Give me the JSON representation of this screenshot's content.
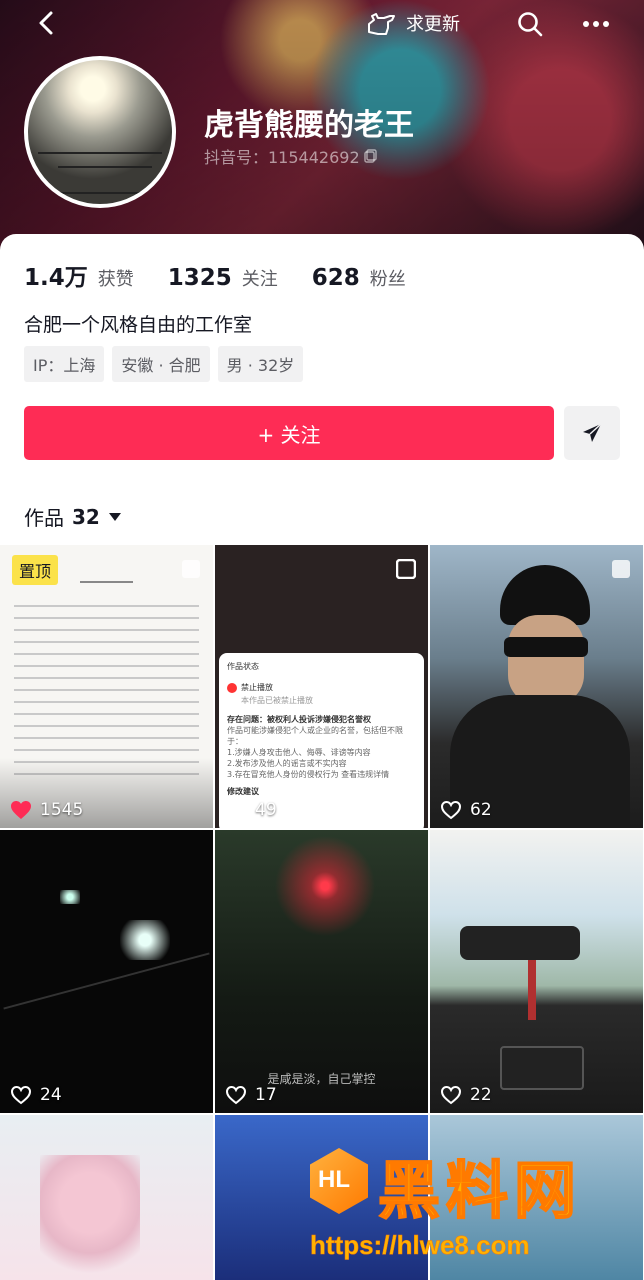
{
  "topbar": {
    "update_label": "求更新"
  },
  "profile": {
    "name": "虎背熊腰的老王",
    "douyin_id": "抖音号：115442692",
    "stats": [
      {
        "num": "1.4万",
        "label": "获赞"
      },
      {
        "num": "1325",
        "label": "关注"
      },
      {
        "num": "628",
        "label": "粉丝"
      }
    ],
    "bio": "合肥一个风格自由的工作室",
    "tags": [
      "IP：上海",
      "安徽 · 合肥",
      "男 · 32岁"
    ]
  },
  "actions": {
    "follow_label": "+ 关注"
  },
  "works": {
    "label": "作品",
    "count": "32"
  },
  "grid": {
    "pinned_label": "置顶",
    "tiles": [
      {
        "likes": "1545",
        "liked": true
      },
      {
        "likes": "49",
        "liked": false
      },
      {
        "likes": "62",
        "liked": false
      },
      {
        "likes": "24",
        "liked": false
      },
      {
        "likes": "17",
        "liked": false
      },
      {
        "likes": "22",
        "liked": false
      }
    ],
    "status_card": {
      "title": "作品状态",
      "banned": "禁止播放",
      "banned_sub": "本作品已被禁止播放",
      "issue": "存在问题：被权利人投诉涉嫌侵犯名誉权",
      "issue_detail_1": "作品可能涉嫌侵犯个人或企业的名誉，包括但不限于：",
      "issue_detail_2": "1.涉嫌人身攻击他人、侮辱、诽谤等内容",
      "issue_detail_3": "2.发布涉及他人的谣言或不实内容",
      "issue_detail_4": "3.存在冒充他人身份的侵权行为 查看违规详情",
      "suggest": "修改建议"
    },
    "tile5_caption": "是咸是淡，自己掌控"
  },
  "watermark": {
    "logo": "HL",
    "name": "黑料网",
    "url": "https://hlwe8.com"
  }
}
